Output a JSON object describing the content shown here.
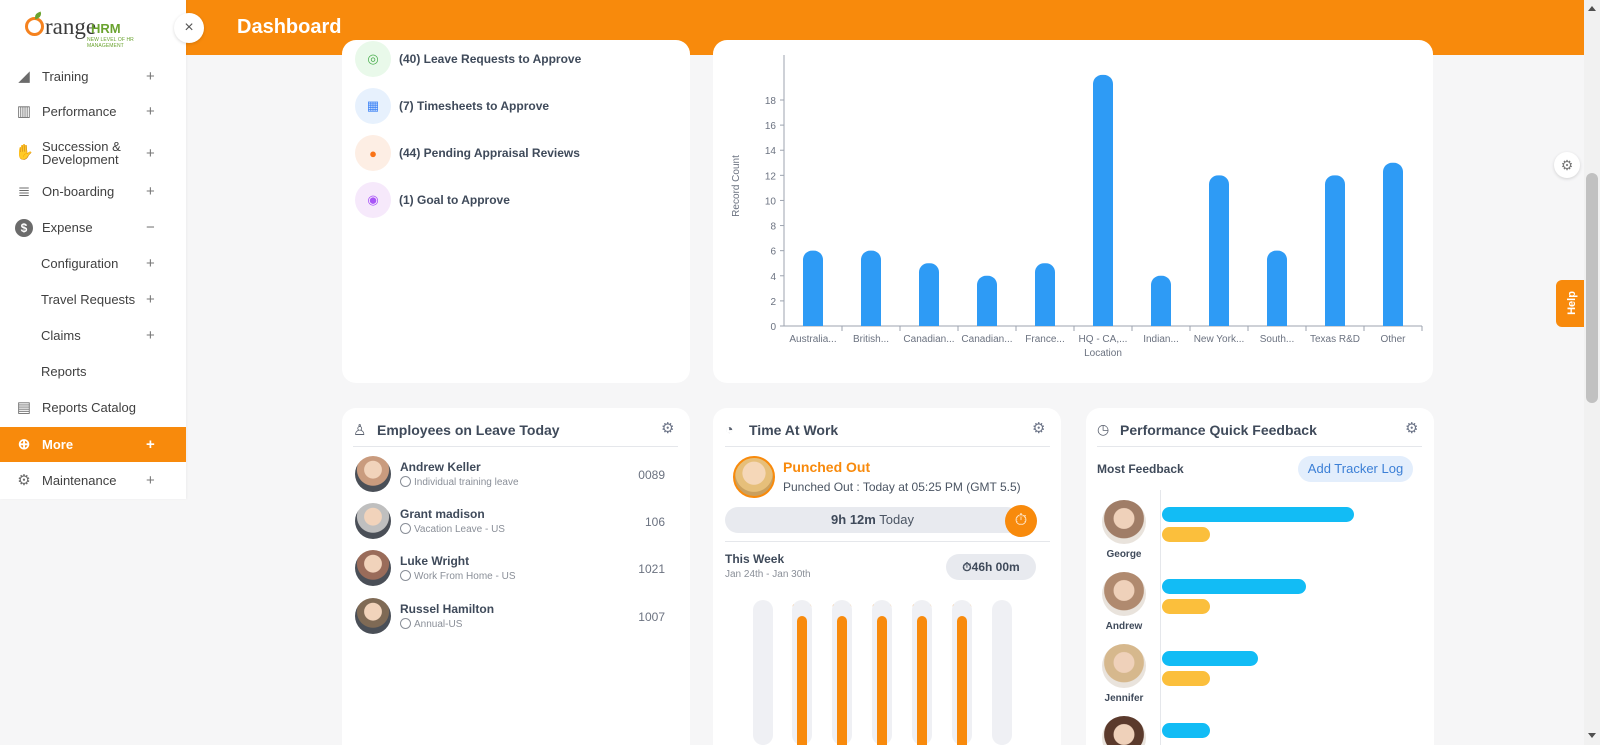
{
  "header": {
    "title": "Dashboard"
  },
  "sidebar": {
    "logo": {
      "brand_a": "range",
      "brand_b": "HRM",
      "tagline": "NEW LEVEL OF HR MANAGEMENT"
    },
    "close_icon": "×",
    "items": [
      {
        "label": "Training",
        "icon": "megaphone-icon",
        "glyph": "◢",
        "toggle": "+"
      },
      {
        "label": "Performance",
        "icon": "bar-chart-icon",
        "glyph": "▥",
        "toggle": "+"
      },
      {
        "label": "Succession & Development",
        "label_line1": "Succession &",
        "label_line2": "Development",
        "icon": "handshake-icon",
        "glyph": "✋",
        "toggle": "+"
      },
      {
        "label": "On-boarding",
        "icon": "layers-icon",
        "glyph": "≣",
        "toggle": "+"
      },
      {
        "label": "Expense",
        "icon": "dollar-icon",
        "glyph": "$",
        "toggle": "−"
      },
      {
        "label": "Configuration",
        "toggle": "+"
      },
      {
        "label": "Travel Requests",
        "toggle": "+"
      },
      {
        "label": "Claims",
        "toggle": "+"
      },
      {
        "label": "Reports",
        "toggle": ""
      },
      {
        "label": "Reports Catalog",
        "icon": "document-icon",
        "glyph": "▤",
        "toggle": ""
      },
      {
        "label": "More",
        "icon": "plus-circle-icon",
        "glyph": "⊕",
        "toggle": "+"
      },
      {
        "label": "Maintenance",
        "icon": "gear-icon",
        "glyph": "⚙",
        "toggle": "+"
      }
    ]
  },
  "pending": {
    "items": [
      {
        "text": "(40) Leave Requests to Approve",
        "icon": "leave-icon",
        "color": "#e9f9ea",
        "glyph": "◎",
        "glyph_color": "#4caf50"
      },
      {
        "text": "(7) Timesheets to Approve",
        "icon": "calendar-icon",
        "color": "#e7f1fd",
        "glyph": "▦",
        "glyph_color": "#3b82f6"
      },
      {
        "text": "(44) Pending Appraisal Reviews",
        "icon": "person-icon",
        "color": "#fdeee4",
        "glyph": "●",
        "glyph_color": "#f97316"
      },
      {
        "text": "(1) Goal to Approve",
        "icon": "target-icon",
        "color": "#f6e9fb",
        "glyph": "◉",
        "glyph_color": "#a855f7"
      }
    ]
  },
  "chart_data": {
    "type": "bar",
    "categories": [
      "Australia...",
      "British...",
      "Canadian...",
      "Canadian...",
      "France...",
      "HQ - CA,...",
      "Indian...",
      "New York...",
      "South...",
      "Texas R&D",
      "Other"
    ],
    "values": [
      6,
      6,
      5,
      4,
      5,
      20,
      4,
      12,
      6,
      12,
      13
    ],
    "xlabel": "Location",
    "ylabel": "Record Count",
    "yticks": [
      0,
      2,
      4,
      6,
      8,
      10,
      12,
      14,
      16,
      18
    ],
    "ylim": [
      0,
      19
    ],
    "color": "#2e9bf5",
    "grid": false
  },
  "employees_on_leave": {
    "title": "Employees on Leave Today",
    "rows": [
      {
        "name": "Andrew Keller",
        "leave": "Individual training leave",
        "id": "0089",
        "avatar": "#c99b7e"
      },
      {
        "name": "Grant madison",
        "leave": "Vacation Leave - US",
        "id": "106",
        "avatar": "#bfbfbf"
      },
      {
        "name": "Luke Wright",
        "leave": "Work From Home - US",
        "id": "1021",
        "avatar": "#9a6c5a"
      },
      {
        "name": "Russel Hamilton",
        "leave": "Annual-US",
        "id": "1007",
        "avatar": "#7f6a55"
      }
    ]
  },
  "time_at_work": {
    "title": "Time At Work",
    "status": "Punched Out",
    "status_detail": "Punched Out : Today at 05:25 PM (GMT 5.5)",
    "today_hours": "9h 12m",
    "today_label": "Today",
    "week_label": "This Week",
    "week_range": "Jan 24th - Jan 30th",
    "week_total": "46h 00m",
    "accent": "#f88a0c",
    "days": [
      {
        "value": "",
        "hours": 0
      },
      {
        "value": "9.20",
        "hours": 9.2
      },
      {
        "value": "9.20",
        "hours": 9.2
      },
      {
        "value": "9.20",
        "hours": 9.2
      },
      {
        "value": "9.20",
        "hours": 9.2
      },
      {
        "value": "9.20",
        "hours": 9.2
      },
      {
        "value": "",
        "hours": 0
      }
    ]
  },
  "quick_feedback": {
    "title": "Performance Quick Feedback",
    "most_feedback": "Most Feedback",
    "add_button": "Add Tracker Log",
    "colors": {
      "primary": "#12bcf5",
      "secondary": "#fbbf3c"
    },
    "people": [
      {
        "name": "George",
        "primary": 0.8,
        "secondary": 0.2,
        "avatar": "#a07d67"
      },
      {
        "name": "Andrew",
        "primary": 0.6,
        "secondary": 0.2,
        "avatar": "#b08a6f"
      },
      {
        "name": "Jennifer",
        "primary": 0.4,
        "secondary": 0.2,
        "avatar": "#d6b88d"
      },
      {
        "name": "",
        "primary": 0.2,
        "secondary": 0,
        "avatar": "#5b3a2c"
      }
    ]
  },
  "help_label": "Help"
}
